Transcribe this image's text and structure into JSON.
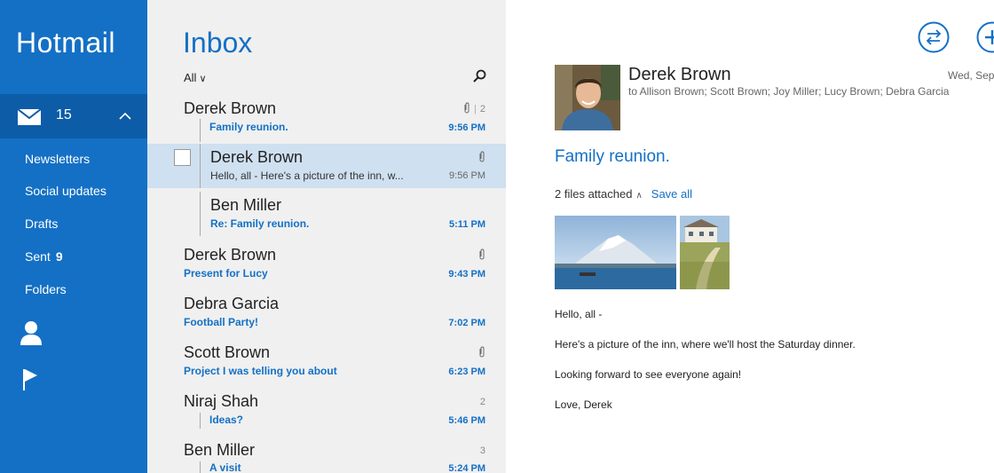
{
  "nav": {
    "app_title": "Hotmail",
    "inbox_count": "15",
    "folders": [
      {
        "label": "Newsletters",
        "badge": ""
      },
      {
        "label": "Social updates",
        "badge": ""
      },
      {
        "label": "Drafts",
        "badge": ""
      },
      {
        "label": "Sent",
        "badge": "9"
      },
      {
        "label": "Folders",
        "badge": ""
      }
    ],
    "icons": [
      "mail-icon",
      "chevron-up-icon",
      "people-icon",
      "flag-icon"
    ]
  },
  "list": {
    "title": "Inbox",
    "filter": "All",
    "messages": [
      {
        "sender": "Derek Brown",
        "subject": "Family reunion.",
        "time": "9:56 PM",
        "count": "2",
        "attachment": true,
        "unread": true
      },
      {
        "sender": "Derek Brown",
        "subject": "Hello, all - Here's a picture of the inn, w...",
        "time": "9:56 PM",
        "count": "",
        "attachment": true,
        "unread": false,
        "selected": true
      },
      {
        "sender": "Ben Miller",
        "subject": "Re: Family reunion.",
        "time": "5:11 PM",
        "count": "",
        "attachment": false,
        "unread": true
      },
      {
        "sender": "Derek Brown",
        "subject": "Present for Lucy",
        "time": "9:43 PM",
        "count": "",
        "attachment": true,
        "unread": true
      },
      {
        "sender": "Debra Garcia",
        "subject": "Football Party!",
        "time": "7:02 PM",
        "count": "",
        "attachment": false,
        "unread": true
      },
      {
        "sender": "Scott Brown",
        "subject": "Project I was telling you about",
        "time": "6:23 PM",
        "count": "",
        "attachment": true,
        "unread": true
      },
      {
        "sender": "Niraj Shah",
        "subject": "Ideas?",
        "time": "5:46 PM",
        "count": "2",
        "attachment": false,
        "unread": true
      },
      {
        "sender": "Ben Miller",
        "subject": "A visit",
        "time": "5:24 PM",
        "count": "3",
        "attachment": false,
        "unread": true
      }
    ]
  },
  "reader": {
    "from": "Derek Brown",
    "to": "to Allison Brown; Scott Brown; Joy Miller; Lucy Brown; Debra Garcia",
    "date": "Wed, Sep",
    "subject": "Family reunion.",
    "attachments_label": "2 files attached",
    "save_all": "Save all",
    "body": [
      "Hello, all -",
      "Here's a picture of the inn, where we'll host the Saturday dinner.",
      "Looking forward to see everyone again!",
      "Love, Derek"
    ]
  },
  "colors": {
    "accent": "#1470c5",
    "nav_selected": "#0d5ca8",
    "list_bg": "#f0f0f0",
    "selected_row": "#cfe0f0"
  }
}
